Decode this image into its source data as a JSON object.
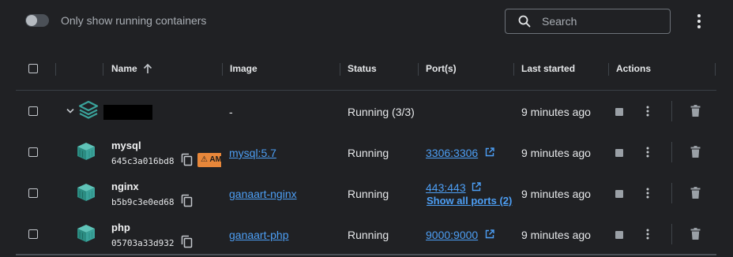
{
  "topbar": {
    "toggle_label": "Only show running containers",
    "toggle_on": false,
    "search_placeholder": "Search"
  },
  "columns": {
    "name": "Name",
    "image": "Image",
    "status": "Status",
    "ports": "Port(s)",
    "last_started": "Last started",
    "actions": "Actions"
  },
  "group": {
    "name": "",
    "image": "-",
    "status": "Running (3/3)",
    "last_started": "9 minutes ago"
  },
  "containers": [
    {
      "name": "mysql",
      "id": "645c3a016bd8",
      "image": "mysql:5.7",
      "status": "Running",
      "port": "3306:3306",
      "last_started": "9 minutes ago",
      "warning_badge": "AM"
    },
    {
      "name": "nginx",
      "id": "b5b9c3e0ed68",
      "image": "ganaart-nginx",
      "status": "Running",
      "port": "443:443",
      "show_all_ports": "Show all ports (2)",
      "last_started": "9 minutes ago"
    },
    {
      "name": "php",
      "id": "05703a33d932",
      "image": "ganaart-php",
      "status": "Running",
      "port": "9000:9000",
      "last_started": "9 minutes ago"
    }
  ],
  "colors": {
    "background": "#202124",
    "link": "#4d9ff5",
    "container_icon": "#3aa29a",
    "warning": "#e8873a"
  },
  "icons": {
    "sort": "arrow-up-icon",
    "expand": "chevron-down-icon",
    "stack": "stack-icon",
    "container": "container-icon",
    "copy": "copy-icon",
    "external": "external-link-icon",
    "stop": "stop-icon",
    "more": "kebab-icon",
    "delete": "trash-icon",
    "search": "search-icon"
  }
}
